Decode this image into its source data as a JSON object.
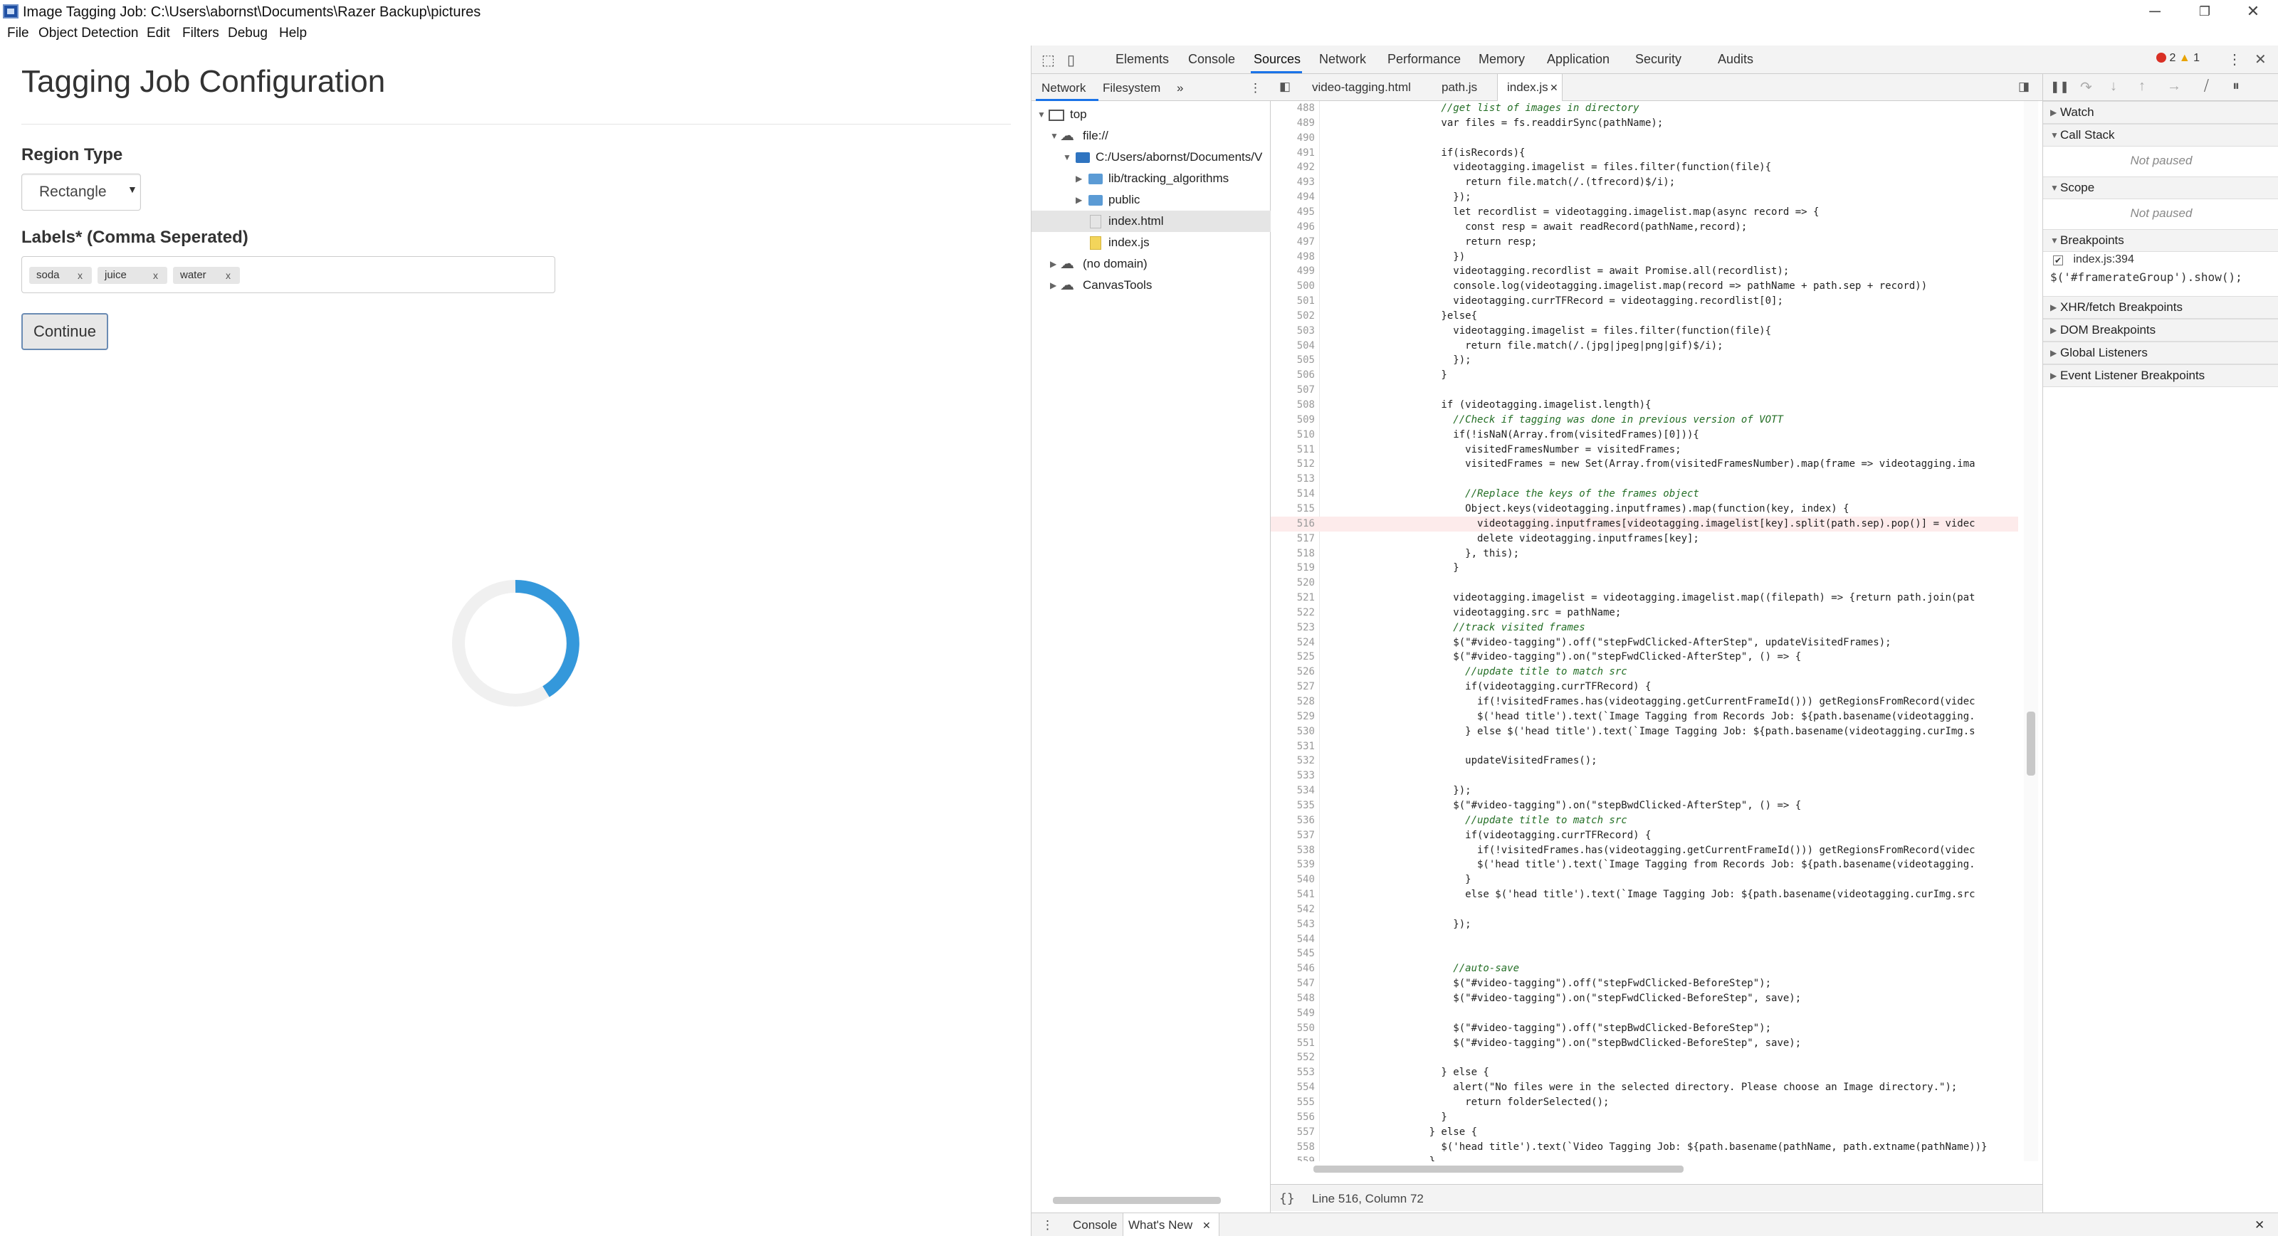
{
  "window": {
    "title": "Image Tagging Job: C:\\Users\\abornst\\Documents\\Razer Backup\\pictures",
    "controls": {
      "minimize": "─",
      "restore": "❐",
      "close": "✕"
    }
  },
  "menubar": [
    "File",
    "Object Detection",
    "Edit",
    "Filters",
    "Debug",
    "Help"
  ],
  "app": {
    "title": "Tagging Job Configuration",
    "region_type_label": "Region Type",
    "region_type_value": "Rectangle",
    "labels_label": "Labels* (Comma Seperated)",
    "tags": [
      "soda",
      "juice",
      "water"
    ],
    "tag_remove": "x",
    "continue_label": "Continue",
    "spinner_color": "#3498db"
  },
  "devtools": {
    "tabs": [
      "Elements",
      "Console",
      "Sources",
      "Network",
      "Performance",
      "Memory",
      "Application",
      "Security",
      "Audits"
    ],
    "active_tab": "Sources",
    "errors": "2",
    "warnings": "1",
    "navigator_tabs": [
      "Network",
      "Filesystem"
    ],
    "tree": [
      {
        "label": "top",
        "indent": 0,
        "kind": "frame",
        "expanded": true
      },
      {
        "label": "file://",
        "indent": 1,
        "kind": "cloud",
        "expanded": true
      },
      {
        "label": "C:/Users/abornst/Documents/V",
        "indent": 2,
        "kind": "folder-dark",
        "expanded": true
      },
      {
        "label": "lib/tracking_algorithms",
        "indent": 3,
        "kind": "folder",
        "expanded": false
      },
      {
        "label": "public",
        "indent": 3,
        "kind": "folder",
        "expanded": false
      },
      {
        "label": "index.html",
        "indent": 3,
        "kind": "html",
        "selected": true
      },
      {
        "label": "index.js",
        "indent": 3,
        "kind": "js"
      },
      {
        "label": "(no domain)",
        "indent": 1,
        "kind": "cloud",
        "expanded": false
      },
      {
        "label": "CanvasTools",
        "indent": 1,
        "kind": "cloud",
        "expanded": false
      }
    ],
    "editor_tabs": [
      "video-tagging.html",
      "path.js",
      "index.js"
    ],
    "active_editor_tab": "index.js",
    "status": "Line 516, Column 72",
    "status_braces": "{}",
    "code": [
      {
        "n": "488",
        "t": "        //get list of images in directory"
      },
      {
        "n": "489",
        "t": "        var files = fs.readdirSync(pathName);"
      },
      {
        "n": "490",
        "t": ""
      },
      {
        "n": "491",
        "t": "        if(isRecords){"
      },
      {
        "n": "492",
        "t": "          videotagging.imagelist = files.filter(function(file){"
      },
      {
        "n": "493",
        "t": "            return file.match(/.(tfrecord)$/i);"
      },
      {
        "n": "494",
        "t": "          });"
      },
      {
        "n": "495",
        "t": "          let recordlist = videotagging.imagelist.map(async record => {"
      },
      {
        "n": "496",
        "t": "            const resp = await readRecord(pathName,record);"
      },
      {
        "n": "497",
        "t": "            return resp;"
      },
      {
        "n": "498",
        "t": "          })"
      },
      {
        "n": "499",
        "t": "          videotagging.recordlist = await Promise.all(recordlist);"
      },
      {
        "n": "500",
        "t": "          console.log(videotagging.imagelist.map(record => pathName + path.sep + record))"
      },
      {
        "n": "501",
        "t": "          videotagging.currTFRecord = videotagging.recordlist[0];"
      },
      {
        "n": "502",
        "t": "        }else{"
      },
      {
        "n": "503",
        "t": "          videotagging.imagelist = files.filter(function(file){"
      },
      {
        "n": "504",
        "t": "            return file.match(/.(jpg|jpeg|png|gif)$/i);"
      },
      {
        "n": "505",
        "t": "          });"
      },
      {
        "n": "506",
        "t": "        }"
      },
      {
        "n": "507",
        "t": ""
      },
      {
        "n": "508",
        "t": "        if (videotagging.imagelist.length){"
      },
      {
        "n": "509",
        "t": "          //Check if tagging was done in previous version of VOTT"
      },
      {
        "n": "510",
        "t": "          if(!isNaN(Array.from(visitedFrames)[0])){"
      },
      {
        "n": "511",
        "t": "            visitedFramesNumber = visitedFrames;"
      },
      {
        "n": "512",
        "t": "            visitedFrames = new Set(Array.from(visitedFramesNumber).map(frame => videotagging.ima"
      },
      {
        "n": "513",
        "t": ""
      },
      {
        "n": "514",
        "t": "            //Replace the keys of the frames object"
      },
      {
        "n": "515",
        "t": "            Object.keys(videotagging.inputframes).map(function(key, index) {"
      },
      {
        "n": "516",
        "t": "              videotagging.inputframes[videotagging.imagelist[key].split(path.sep).pop()] = videc"
      },
      {
        "n": "517",
        "t": "              delete videotagging.inputframes[key];"
      },
      {
        "n": "518",
        "t": "            }, this);"
      },
      {
        "n": "519",
        "t": "          }"
      },
      {
        "n": "520",
        "t": ""
      },
      {
        "n": "521",
        "t": "          videotagging.imagelist = videotagging.imagelist.map((filepath) => {return path.join(pat"
      },
      {
        "n": "522",
        "t": "          videotagging.src = pathName;"
      },
      {
        "n": "523",
        "t": "          //track visited frames"
      },
      {
        "n": "524",
        "t": "          $(\"#video-tagging\").off(\"stepFwdClicked-AfterStep\", updateVisitedFrames);"
      },
      {
        "n": "525",
        "t": "          $(\"#video-tagging\").on(\"stepFwdClicked-AfterStep\", () => {"
      },
      {
        "n": "526",
        "t": "            //update title to match src"
      },
      {
        "n": "527",
        "t": "            if(videotagging.currTFRecord) {"
      },
      {
        "n": "528",
        "t": "              if(!visitedFrames.has(videotagging.getCurrentFrameId())) getRegionsFromRecord(videc"
      },
      {
        "n": "529",
        "t": "              $('head title').text(`Image Tagging from Records Job: ${path.basename(videotagging."
      },
      {
        "n": "530",
        "t": "            } else $('head title').text(`Image Tagging Job: ${path.basename(videotagging.curImg.s"
      },
      {
        "n": "531",
        "t": ""
      },
      {
        "n": "532",
        "t": "            updateVisitedFrames();"
      },
      {
        "n": "533",
        "t": ""
      },
      {
        "n": "534",
        "t": "          });"
      },
      {
        "n": "535",
        "t": "          $(\"#video-tagging\").on(\"stepBwdClicked-AfterStep\", () => {"
      },
      {
        "n": "536",
        "t": "            //update title to match src"
      },
      {
        "n": "537",
        "t": "            if(videotagging.currTFRecord) {"
      },
      {
        "n": "538",
        "t": "              if(!visitedFrames.has(videotagging.getCurrentFrameId())) getRegionsFromRecord(videc"
      },
      {
        "n": "539",
        "t": "              $('head title').text(`Image Tagging from Records Job: ${path.basename(videotagging."
      },
      {
        "n": "540",
        "t": "            }"
      },
      {
        "n": "541",
        "t": "            else $('head title').text(`Image Tagging Job: ${path.basename(videotagging.curImg.src"
      },
      {
        "n": "542",
        "t": ""
      },
      {
        "n": "543",
        "t": "          });"
      },
      {
        "n": "544",
        "t": ""
      },
      {
        "n": "545",
        "t": ""
      },
      {
        "n": "546",
        "t": "          //auto-save"
      },
      {
        "n": "547",
        "t": "          $(\"#video-tagging\").off(\"stepFwdClicked-BeforeStep\");"
      },
      {
        "n": "548",
        "t": "          $(\"#video-tagging\").on(\"stepFwdClicked-BeforeStep\", save);"
      },
      {
        "n": "549",
        "t": ""
      },
      {
        "n": "550",
        "t": "          $(\"#video-tagging\").off(\"stepBwdClicked-BeforeStep\");"
      },
      {
        "n": "551",
        "t": "          $(\"#video-tagging\").on(\"stepBwdClicked-BeforeStep\", save);"
      },
      {
        "n": "552",
        "t": ""
      },
      {
        "n": "553",
        "t": "        } else {"
      },
      {
        "n": "554",
        "t": "          alert(\"No files were in the selected directory. Please choose an Image directory.\");"
      },
      {
        "n": "555",
        "t": "            return folderSelected();"
      },
      {
        "n": "556",
        "t": "        }"
      },
      {
        "n": "557",
        "t": "      } else {"
      },
      {
        "n": "558",
        "t": "        $('head title').text(`Video Tagging Job: ${path.basename(pathName, path.extname(pathName))}"
      },
      {
        "n": "559",
        "t": "      }"
      }
    ],
    "highlight_line": "516",
    "sidebar": {
      "sections": [
        "Watch",
        "Call Stack",
        "Scope",
        "Breakpoints",
        "XHR/fetch Breakpoints",
        "DOM Breakpoints",
        "Global Listeners",
        "Event Listener Breakpoints"
      ],
      "not_paused": "Not paused",
      "breakpoint_file": "index.js:394",
      "breakpoint_code": "$('#framerateGroup').show();"
    },
    "drawer_tabs": [
      "Console",
      "What's New"
    ],
    "active_drawer_tab": "What's New"
  }
}
